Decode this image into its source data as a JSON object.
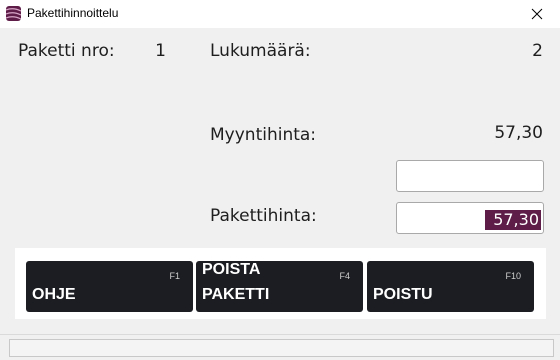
{
  "window": {
    "title": "Pakettihinnoittelu",
    "icon": "app-logo-icon",
    "close_icon": "close-icon"
  },
  "form": {
    "package_no_label": "Paketti nro:",
    "package_no_value": "1",
    "quantity_label": "Lukumäärä:",
    "quantity_value": "2",
    "sale_price_label": "Myyntihinta:",
    "sale_price_value": "57,30",
    "extra_field_value": "",
    "package_price_label": "Pakettihinta:",
    "package_price_value": "57,30"
  },
  "buttons": [
    {
      "label": "OHJE",
      "key": "F1"
    },
    {
      "label": "POISTA PAKETTI",
      "line1": "POISTA",
      "line2": "PAKETTI",
      "key": "F4"
    },
    {
      "label": "POISTU",
      "key": "F10"
    }
  ],
  "status": {
    "text": ""
  },
  "colors": {
    "selection": "#5e1d48",
    "button_bg": "#1b1d22",
    "background": "#f0f0f0"
  }
}
